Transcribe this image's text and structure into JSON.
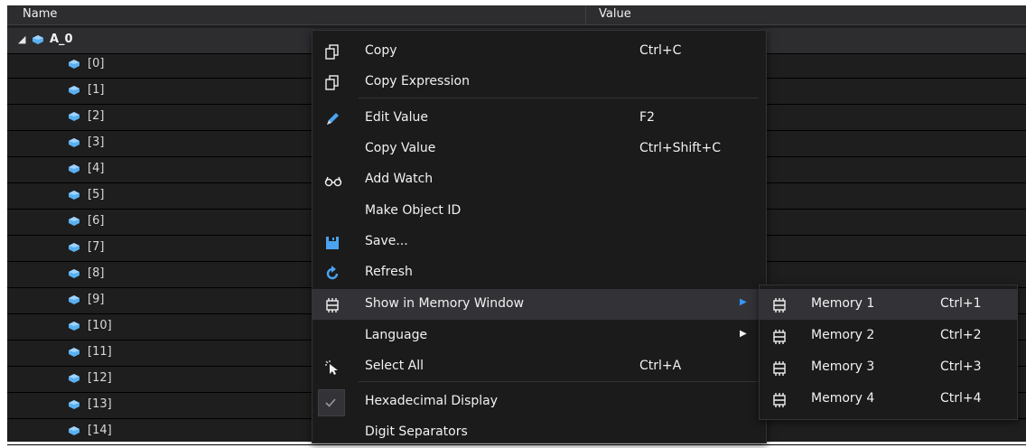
{
  "header": {
    "name_col": "Name",
    "value_col": "Value"
  },
  "tree": {
    "root": "A_0",
    "children": [
      "[0]",
      "[1]",
      "[2]",
      "[3]",
      "[4]",
      "[5]",
      "[6]",
      "[7]",
      "[8]",
      "[9]",
      "[10]",
      "[11]",
      "[12]",
      "[13]",
      "[14]"
    ]
  },
  "context_menu": {
    "items": [
      {
        "label": "Copy",
        "shortcut": "Ctrl+C",
        "icon": "copy-icon"
      },
      {
        "label": "Copy Expression",
        "shortcut": "",
        "icon": "copy-icon"
      },
      {
        "label": "Edit Value",
        "shortcut": "F2",
        "icon": "pencil-icon"
      },
      {
        "label": "Copy Value",
        "shortcut": "Ctrl+Shift+C",
        "icon": ""
      },
      {
        "label": "Add Watch",
        "shortcut": "",
        "icon": "glasses-icon"
      },
      {
        "label": "Make Object ID",
        "shortcut": "",
        "icon": ""
      },
      {
        "label": "Save...",
        "shortcut": "",
        "icon": "save-icon"
      },
      {
        "label": "Refresh",
        "shortcut": "",
        "icon": "refresh-icon"
      },
      {
        "label": "Show in Memory Window",
        "shortcut": "",
        "icon": "memory-chip-icon",
        "submenu": true,
        "highlighted": true
      },
      {
        "label": "Language",
        "shortcut": "",
        "icon": "",
        "submenu": true
      },
      {
        "label": "Select All",
        "shortcut": "Ctrl+A",
        "icon": "select-all-icon"
      },
      {
        "label": "Hexadecimal Display",
        "shortcut": "",
        "icon": "checkmark-icon",
        "checked": true
      },
      {
        "label": "Digit Separators",
        "shortcut": "",
        "icon": ""
      }
    ]
  },
  "memory_submenu": {
    "items": [
      {
        "label": "Memory 1",
        "shortcut": "Ctrl+1",
        "highlighted": true
      },
      {
        "label": "Memory 2",
        "shortcut": "Ctrl+2"
      },
      {
        "label": "Memory 3",
        "shortcut": "Ctrl+3"
      },
      {
        "label": "Memory 4",
        "shortcut": "Ctrl+4"
      }
    ]
  },
  "colors": {
    "background": "#1e1e1e",
    "menu_background": "#1b1b1c",
    "highlight": "#333337",
    "gem": "#5ab0f0",
    "accent": "#3399ff"
  }
}
